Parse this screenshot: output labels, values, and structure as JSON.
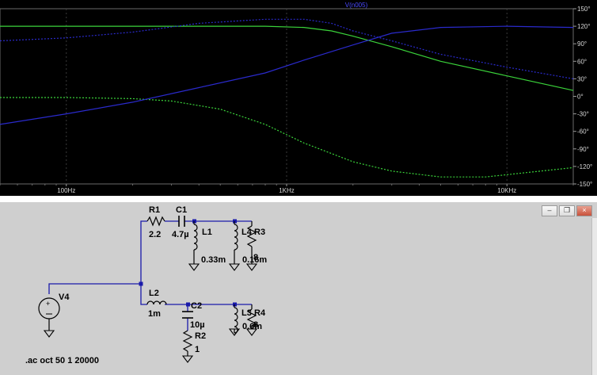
{
  "plot": {
    "trace_label": "V(n005)",
    "right_axis_ticks": [
      "150°",
      "120°",
      "90°",
      "60°",
      "30°",
      "0°",
      "-30°",
      "-60°",
      "-90°",
      "-120°",
      "-150°"
    ],
    "x_ticks": [
      "100Hz",
      "1KHz",
      "10KHz"
    ]
  },
  "chart_data": {
    "type": "line",
    "x_scale": "log",
    "xlim": [
      50,
      20000
    ],
    "y2lim": [
      -150,
      150
    ],
    "y2_label": "",
    "series": [
      {
        "color": "#3ad33a",
        "style": "solid",
        "x": [
          50,
          100,
          200,
          400,
          800,
          1200,
          1600,
          2000,
          3000,
          5000,
          10000,
          20000
        ],
        "y": [
          120,
          120,
          120,
          120,
          120,
          118,
          112,
          103,
          85,
          60,
          35,
          10
        ]
      },
      {
        "color": "#3ad33a",
        "style": "dashed",
        "x": [
          50,
          100,
          200,
          300,
          500,
          800,
          1200,
          2000,
          3000,
          5000,
          8000,
          20000
        ],
        "y": [
          -2,
          -2,
          -4,
          -8,
          -22,
          -48,
          -80,
          -112,
          -128,
          -138,
          -138,
          -122
        ]
      },
      {
        "color": "#2a2acc",
        "style": "solid",
        "x": [
          50,
          100,
          200,
          400,
          800,
          1200,
          2000,
          3000,
          5000,
          10000,
          20000
        ],
        "y": [
          -48,
          -30,
          -10,
          15,
          40,
          62,
          88,
          108,
          118,
          120,
          118
        ]
      },
      {
        "color": "#2a2acc",
        "style": "dashed",
        "x": [
          50,
          100,
          200,
          400,
          800,
          1200,
          1600,
          2000,
          3000,
          5000,
          10000,
          20000
        ],
        "y": [
          95,
          100,
          110,
          125,
          132,
          132,
          125,
          112,
          95,
          72,
          50,
          30
        ]
      }
    ]
  },
  "schematic": {
    "components": {
      "R1": {
        "name": "R1",
        "value": "2.2"
      },
      "C1": {
        "name": "C1",
        "value": "4.7µ"
      },
      "L1": {
        "name": "L1",
        "value": "0.33m"
      },
      "L4": {
        "name": "L4",
        "value": "0.16m"
      },
      "R3": {
        "name": "R3",
        "value": "8"
      },
      "V4": {
        "name": "V4"
      },
      "L2": {
        "name": "L2",
        "value": "1m"
      },
      "C2": {
        "name": "C2",
        "value": "10µ"
      },
      "R2": {
        "name": "R2",
        "value": "1"
      },
      "L3": {
        "name": "L3",
        "value": "0.6m"
      },
      "R4": {
        "name": "R4",
        "value": "8"
      }
    },
    "directive": ".ac oct 50 1 20000"
  },
  "colors": {
    "plot_bg": "#000000",
    "wire": "#1a1aaa",
    "grid": "#3a3a3a"
  }
}
